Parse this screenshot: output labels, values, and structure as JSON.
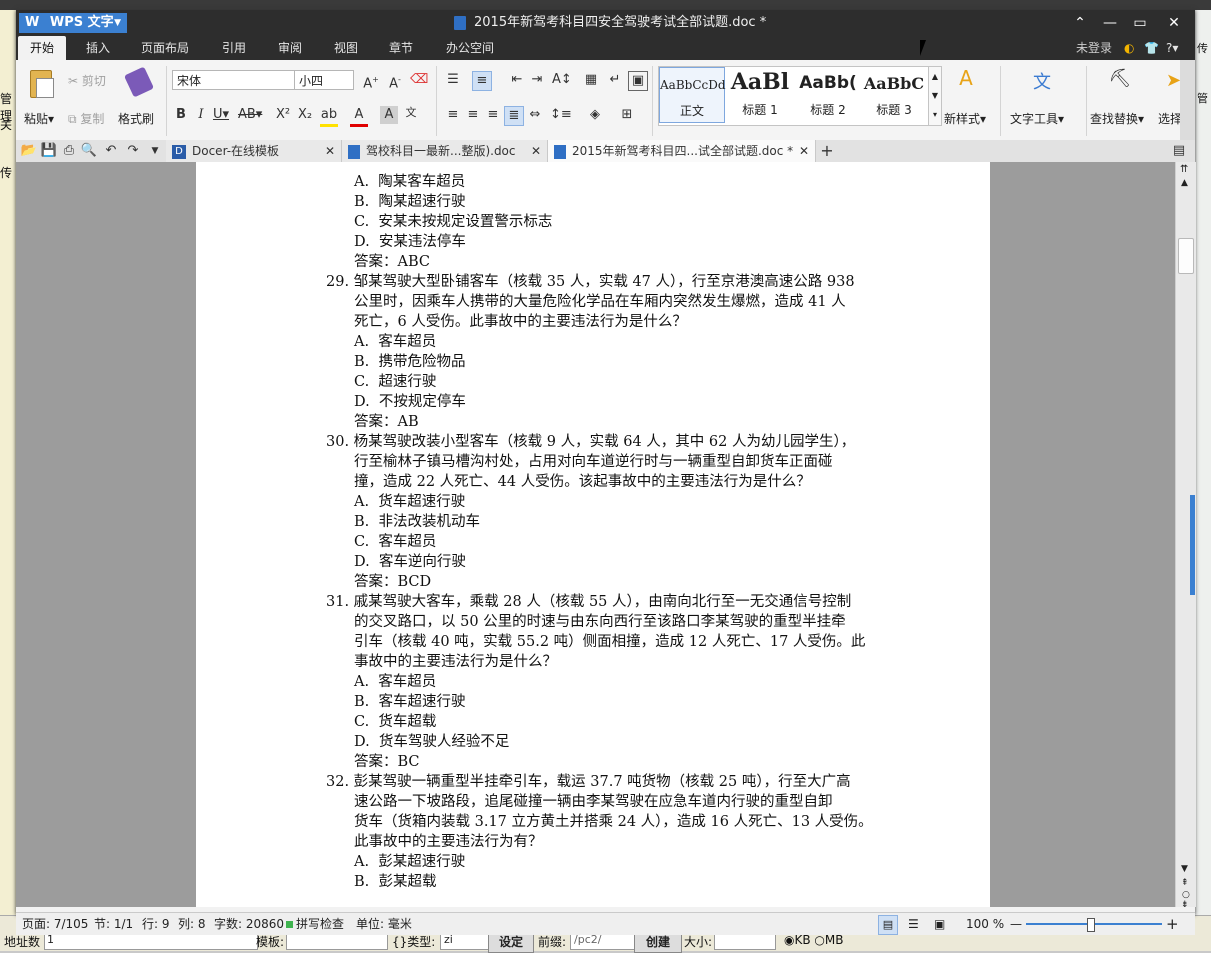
{
  "app": {
    "name": "WPS 文字",
    "window_title": "2015年新驾考科目四安全驾驶考试全部试题.doc *",
    "login": "未登录",
    "help": "?"
  },
  "menu": [
    "开始",
    "插入",
    "页面布局",
    "引用",
    "审阅",
    "视图",
    "章节",
    "办公空间"
  ],
  "ribbon": {
    "paste": "粘贴",
    "cut": "剪切",
    "copy": "复制",
    "format_painter": "格式刷",
    "font_name": "宋体",
    "font_size": "小四",
    "styles": [
      {
        "sample": "AaBbCcDd",
        "label": "正文"
      },
      {
        "sample": "AaBl",
        "label": "标题 1"
      },
      {
        "sample": "AaBb(",
        "label": "标题 2"
      },
      {
        "sample": "AaBbC",
        "label": "标题 3"
      }
    ],
    "new_style": "新样式",
    "text_tools": "文字工具",
    "find_replace": "查找替换",
    "select": "选择"
  },
  "tabs": [
    {
      "label": "Docer-在线模板"
    },
    {
      "label": "驾校科目一最新...整版).doc"
    },
    {
      "label": "2015年新驾考科目四...试全部试题.doc *"
    }
  ],
  "document": {
    "lines": [
      {
        "indent": 2,
        "text": "A.  陶某客车超员"
      },
      {
        "indent": 2,
        "text": "B.  陶某超速行驶"
      },
      {
        "indent": 2,
        "text": "C.  安某未按规定设置警示标志"
      },
      {
        "indent": 2,
        "text": "D.  安某违法停车"
      },
      {
        "indent": 2,
        "text": "答案：ABC"
      },
      {
        "indent": 0,
        "text": "29. 邹某驾驶大型卧铺客车（核载 35 人，实载 47 人），行至京港澳高速公路 938"
      },
      {
        "indent": 1,
        "text": "公里时，因乘车人携带的大量危险化学品在车厢内突然发生爆燃，造成 41 人"
      },
      {
        "indent": 1,
        "text": "死亡，6 人受伤。此事故中的主要违法行为是什么？"
      },
      {
        "indent": 2,
        "text": "A.  客车超员"
      },
      {
        "indent": 2,
        "text": "B.  携带危险物品"
      },
      {
        "indent": 2,
        "text": "C.  超速行驶"
      },
      {
        "indent": 2,
        "text": "D.  不按规定停车"
      },
      {
        "indent": 2,
        "text": "答案：AB"
      },
      {
        "indent": 0,
        "text": "30. 杨某驾驶改装小型客车（核载 9 人，实载 64 人，其中 62 人为幼儿园学生），"
      },
      {
        "indent": 1,
        "text": "行至榆林子镇马槽沟村处，占用对向车道逆行时与一辆重型自卸货车正面碰"
      },
      {
        "indent": 1,
        "text": "撞，造成 22 人死亡、44 人受伤。该起事故中的主要违法行为是什么？"
      },
      {
        "indent": 2,
        "text": "A.  货车超速行驶"
      },
      {
        "indent": 2,
        "text": "B.  非法改装机动车"
      },
      {
        "indent": 2,
        "text": "C.  客车超员"
      },
      {
        "indent": 2,
        "text": "D.  客车逆向行驶"
      },
      {
        "indent": 2,
        "text": "答案：BCD"
      },
      {
        "indent": 0,
        "text": "31. 戚某驾驶大客车，乘载 28 人（核载 55 人），由南向北行至一无交通信号控制"
      },
      {
        "indent": 1,
        "text": "的交叉路口，以 50 公里的时速与由东向西行至该路口李某驾驶的重型半挂牵"
      },
      {
        "indent": 1,
        "text": "引车（核载 40 吨，实载 55.2 吨）侧面相撞，造成 12 人死亡、17 人受伤。此"
      },
      {
        "indent": 1,
        "text": "事故中的主要违法行为是什么？"
      },
      {
        "indent": 2,
        "text": "A.  客车超员"
      },
      {
        "indent": 2,
        "text": "B.  客车超速行驶"
      },
      {
        "indent": 2,
        "text": "C.  货车超载"
      },
      {
        "indent": 2,
        "text": "D.  货车驾驶人经验不足"
      },
      {
        "indent": 2,
        "text": "答案：BC"
      },
      {
        "indent": 0,
        "text": "32. 彭某驾驶一辆重型半挂牵引车，载运 37.7 吨货物（核载 25 吨），行至大广高"
      },
      {
        "indent": 1,
        "text": "速公路一下坡路段，追尾碰撞一辆由李某驾驶在应急车道内行驶的重型自卸"
      },
      {
        "indent": 1,
        "text": "货车（货箱内装载 3.17 立方黄土并搭乘 24 人），造成 16 人死亡、13 人受伤。"
      },
      {
        "indent": 1,
        "text": "此事故中的主要违法行为有？"
      },
      {
        "indent": 2,
        "text": "A.  彭某超速行驶"
      },
      {
        "indent": 2,
        "text": "B.  彭某超载"
      }
    ]
  },
  "status": {
    "page": "页面: 7/105",
    "section": "节: 1/1",
    "row": "行: 9",
    "col": "列: 8",
    "words": "字数: 20860",
    "spell": "拼写检查",
    "unit": "单位: 毫米",
    "zoom": "100 %",
    "zoom_fraction": 0.47
  },
  "background_app": {
    "left_labels": [
      "管理",
      "关",
      "传"
    ],
    "right_labels": [
      "传",
      "管"
    ],
    "bottom": {
      "address": "地址数",
      "address_value": "1",
      "template": "模板:",
      "type": "{}类型:",
      "type_value": "zi",
      "set": "设定",
      "prefix": "前缀:",
      "prefix_value": "/pc2/",
      "create": "创建",
      "size": "大小:",
      "kb": "KB",
      "mb": "MB"
    }
  },
  "colors": {
    "titlebar": "#2d2d2d",
    "wps_blue": "#3b80d1",
    "page": "#ffffff",
    "workspace": "#9c9c9c"
  }
}
